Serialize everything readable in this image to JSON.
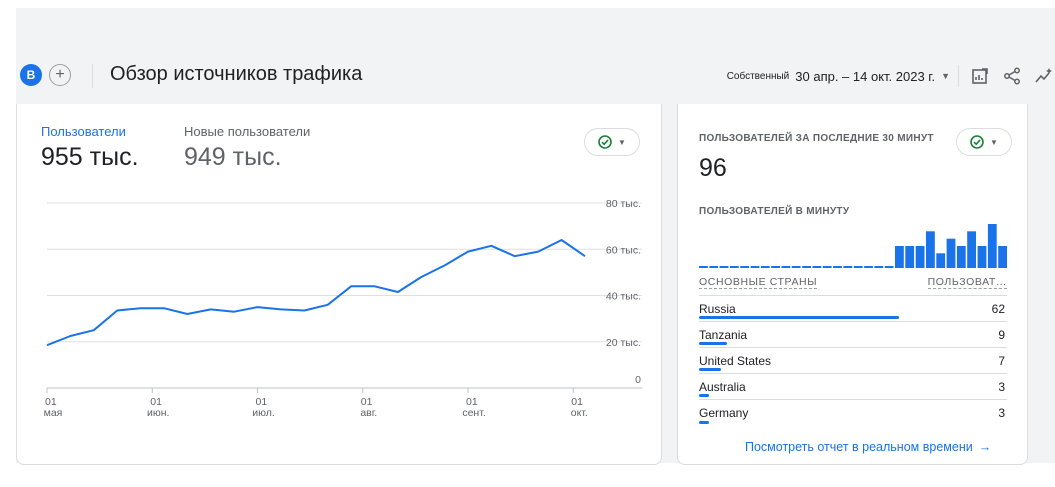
{
  "header": {
    "avatar_letter": "B",
    "add_symbol": "+",
    "title": "Обзор источников трафика",
    "compare_label": "Собственный",
    "date_range": "30 апр. – 14 окт. 2023 г.",
    "icons": [
      "customize-report-icon",
      "share-icon",
      "insights-icon"
    ]
  },
  "metrics": {
    "users_label": "Пользователи",
    "users_value": "955 тыс.",
    "new_users_label": "Новые пользователи",
    "new_users_value": "949 тыс."
  },
  "chart_data": {
    "type": "line",
    "y_tick_labels": [
      "80 тыс.",
      "60 тыс.",
      "40 тыс.",
      "20 тыс.",
      "0"
    ],
    "y_ticks": [
      80000,
      60000,
      40000,
      20000,
      0
    ],
    "ylim": [
      0,
      80000
    ],
    "x_ticks": [
      {
        "day": "01",
        "month": "мая",
        "index": 0
      },
      {
        "day": "01",
        "month": "июн.",
        "index": 4.5
      },
      {
        "day": "01",
        "month": "июл.",
        "index": 9
      },
      {
        "day": "01",
        "month": "авг.",
        "index": 13.5
      },
      {
        "day": "01",
        "month": "сент.",
        "index": 18
      },
      {
        "day": "01",
        "month": "окт.",
        "index": 22.5
      }
    ],
    "series": [
      {
        "values": [
          18500,
          22500,
          25000,
          33500,
          34500,
          34500,
          32000,
          34000,
          33000,
          35000,
          34000,
          33500,
          36000,
          44000,
          44000,
          41500,
          48000,
          53000,
          59000,
          61500,
          57000,
          59000,
          64000,
          57000
        ],
        "color": "#1a73e8"
      }
    ],
    "grid": true,
    "legend": "none"
  },
  "realtime": {
    "title": "ПОЛЬЗОВАТЕЛЕЙ ЗА ПОСЛЕДНИЕ 30 МИНУТ",
    "value": "96",
    "per_minute_label": "ПОЛЬЗОВАТЕЛЕЙ В МИНУТУ",
    "per_minute_values": [
      0,
      0,
      0,
      0,
      0,
      0,
      0,
      0,
      0,
      0,
      0,
      0,
      0,
      0,
      0,
      0,
      0,
      0,
      0,
      3,
      3,
      3,
      5,
      2,
      4,
      3,
      5,
      3,
      6,
      3
    ],
    "countries_header": "ОСНОВНЫЕ СТРАНЫ",
    "users_header": "ПОЛЬЗОВАТ…",
    "countries": [
      {
        "name": "Russia",
        "value": "62",
        "share": 0.65
      },
      {
        "name": "Tanzania",
        "value": "9",
        "share": 0.09
      },
      {
        "name": "United States",
        "value": "7",
        "share": 0.07
      },
      {
        "name": "Australia",
        "value": "3",
        "share": 0.03
      },
      {
        "name": "Germany",
        "value": "3",
        "share": 0.03
      }
    ],
    "link_label": "Посмотреть отчет в реальном времени",
    "link_arrow": "→"
  },
  "colors": {
    "accent": "#1a73e8",
    "success": "#188038",
    "muted": "#5f6368",
    "grid": "#e0e0e0"
  }
}
